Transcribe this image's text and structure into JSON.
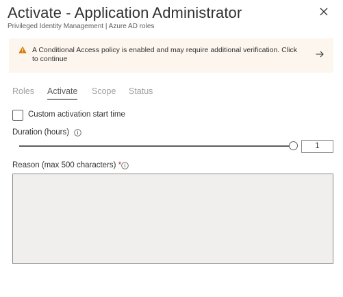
{
  "header": {
    "title": "Activate - Application Administrator",
    "subtitle": "Privileged Identity Management | Azure AD roles",
    "close_icon": "close-icon"
  },
  "banner": {
    "icon": "warning-icon",
    "message": "A Conditional Access policy is enabled and may require additional verification. Click to continue",
    "arrow_icon": "arrow-right-icon",
    "background": "#fdf6ee",
    "icon_color": "#d47a00"
  },
  "tabs": [
    {
      "label": "Roles",
      "active": false
    },
    {
      "label": "Activate",
      "active": true
    },
    {
      "label": "Scope",
      "active": false
    },
    {
      "label": "Status",
      "active": false
    }
  ],
  "form": {
    "custom_start": {
      "label": "Custom activation start time",
      "checked": false
    },
    "duration": {
      "label": "Duration (hours)",
      "value": "1"
    },
    "reason": {
      "label": "Reason (max 500 characters)",
      "required_marker": "*",
      "value": ""
    }
  },
  "colors": {
    "required": "#a4262c",
    "text": "#323130"
  }
}
